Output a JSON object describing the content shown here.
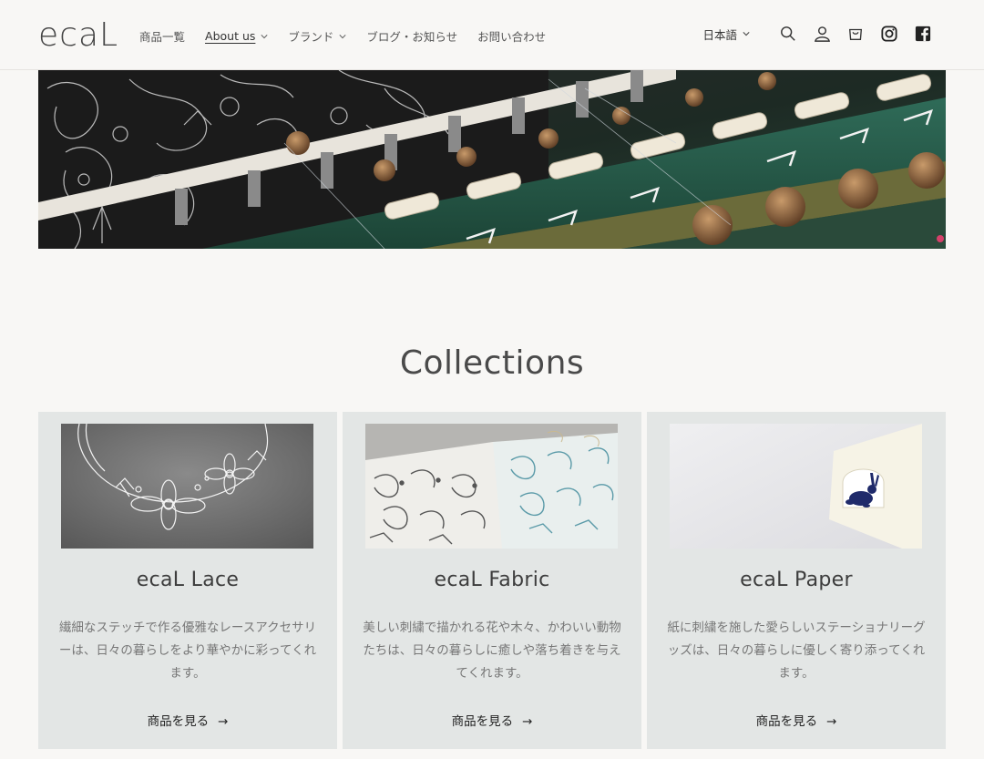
{
  "header": {
    "logo": "ecaL",
    "nav": [
      {
        "label": "商品一覧",
        "dropdown": false
      },
      {
        "label": "About us",
        "dropdown": true
      },
      {
        "label": "ブランド",
        "dropdown": true
      },
      {
        "label": "ブログ・お知らせ",
        "dropdown": false
      },
      {
        "label": "お問い合わせ",
        "dropdown": false
      }
    ],
    "language": "日本語",
    "icons": [
      "search-icon",
      "account-icon",
      "cart-icon",
      "instagram-icon",
      "facebook-icon"
    ]
  },
  "collections": {
    "title": "Collections",
    "cards": [
      {
        "title": "ecaL Lace",
        "description": "繊細なステッチで作る優雅なレースアクセサリーは、日々の暮らしをより華やかに彩ってくれます。",
        "link": "商品を見る"
      },
      {
        "title": "ecaL Fabric",
        "description": "美しい刺繍で描かれる花や木々、かわいい動物たちは、日々の暮らしに癒しや落ち着きを与えてくれます。",
        "link": "商品を見る"
      },
      {
        "title": "ecaL Paper",
        "description": "紙に刺繍を施した愛らしいステーショナリーグッズは、日々の暮らしに優しく寄り添ってくれます。",
        "link": "商品を見る"
      }
    ]
  },
  "colors": {
    "background": "#f8f7f5",
    "card": "#e3e6e5",
    "text": "#333333"
  }
}
